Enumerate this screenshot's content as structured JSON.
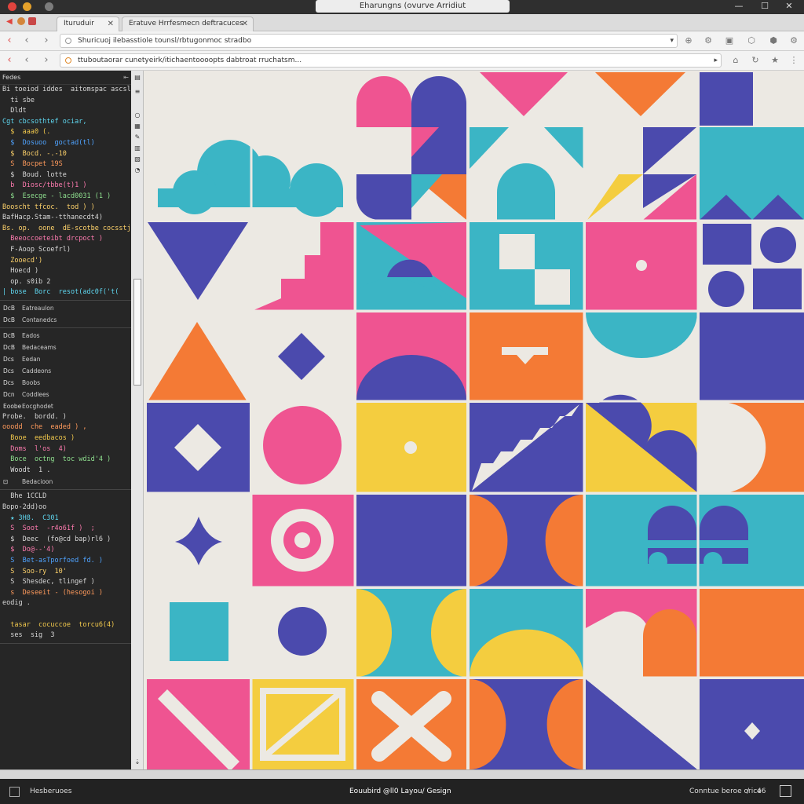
{
  "window": {
    "title": "Eharungns (ovurve Arridiut",
    "minimize_glyph": "—",
    "maximize_glyph": "☐",
    "close_glyph": "✕"
  },
  "tabs": [
    {
      "label": "Ituruduir",
      "close": "✕"
    },
    {
      "label": "Eratuve Hrrfesmecn deftracuces",
      "close": "✕"
    }
  ],
  "nav1": {
    "url": "Shuricuoj ilebasstiole tounsl/rbtugonmoc stradbo"
  },
  "nav2": {
    "url": "ttuboutaorar cunetyeirk/itichaentoooopts dabtroat rruchatsm..."
  },
  "sidebar": {
    "header": "Fedes",
    "code_lines_1": [
      {
        "text": "Bi toeiod iddes  aitomspac ascslti  t i d",
        "color": "#d8d8d8"
      },
      {
        "text": "  ti sbe",
        "color": "#d8d8d8"
      },
      {
        "text": "  Dldt",
        "color": "#d8d8d8"
      },
      {
        "text": "Cgt cbcsothtef ociar,",
        "color": "#5fd7f0"
      },
      {
        "text": "  $  aaa0 (.",
        "color": "#f2c94c"
      },
      {
        "text": "  $  Dosuoo  goctad(tl)",
        "color": "#4fa3ff"
      },
      {
        "text": "  $  Bocd. -.-10",
        "color": "#ffd36b"
      },
      {
        "text": "  S  Bocpet 19S",
        "color": "#ff9a5c"
      },
      {
        "text": "  $  Boud. lotte",
        "color": "#d8d8d8"
      },
      {
        "text": "  b  Diosc/tbbe(t)1 )",
        "color": "#ff7bb0"
      },
      {
        "text": "  $  Esecge - lacd0031 (1 )",
        "color": "#8fe08f"
      },
      {
        "text": "Booscht tfcoc.  tod ) )",
        "color": "#ffd36b"
      },
      {
        "text": "BafHacp.Stam--tthanecdt4)",
        "color": "#d8d8d8"
      },
      {
        "text": "Bs. op.  oone  dE-scotbe cocsstjt )",
        "color": "#ffd36b"
      },
      {
        "text": "  Beeoccoeteibt drcpoct )",
        "color": "#ff7bb0"
      },
      {
        "text": "  F-Aoop Scoefrl)",
        "color": "#d8d8d8"
      },
      {
        "text": "  Zooecd')",
        "color": "#ffd36b"
      },
      {
        "text": "  Hoecd )",
        "color": "#d8d8d8"
      },
      {
        "text": "  op. s0ib 2",
        "color": "#d8d8d8"
      },
      {
        "text": "| bose  Borc  resot(adc0f('t(",
        "color": "#5fd7f0"
      }
    ],
    "files_1": [
      {
        "icon": "DcB",
        "name": "Eatreaulon"
      },
      {
        "icon": "DcB",
        "name": "Contanedcs"
      }
    ],
    "files_2": [
      {
        "icon": "DcB",
        "name": "Eados"
      },
      {
        "icon": "DcB",
        "name": "Bedaceams"
      },
      {
        "icon": "Dcs",
        "name": "Eedan"
      },
      {
        "icon": "Dcs",
        "name": "Caddeons"
      },
      {
        "icon": "Dcs",
        "name": "Boobs"
      },
      {
        "icon": "Dcn",
        "name": "Coddlees"
      },
      {
        "icon": "Eoobe",
        "name": "Eocghodet"
      }
    ],
    "code_lines_2": [
      {
        "text": "Probe.  bordd. )",
        "color": "#d8d8d8"
      },
      {
        "text": "ooodd  che  eaded ) ,",
        "color": "#ff9a5c"
      },
      {
        "text": "  Booe  eedbacos )",
        "color": "#f2c94c"
      },
      {
        "text": "  Doms  l'os  4)",
        "color": "#ff7bb0"
      },
      {
        "text": "  Boce  octng  toc wdid'4 )",
        "color": "#8fe08f"
      },
      {
        "text": "  Woodt  1 .",
        "color": "#d8d8d8"
      }
    ],
    "files_3": [
      {
        "icon": "⊡",
        "name": "Bedacioon"
      }
    ],
    "code_lines_3": [
      {
        "text": "  Bhe 1CCLD",
        "color": "#d8d8d8"
      },
      {
        "text": "Bopo-2dd)oo",
        "color": "#d8d8d8"
      },
      {
        "text": "  ★ 3H8.  C301",
        "color": "#5fd7f0"
      },
      {
        "text": "  S  Soot  -r4o61f )  ;",
        "color": "#ff7bb0"
      },
      {
        "text": "  $  Deec  (fo@cd bap)rl6 )",
        "color": "#d8d8d8"
      },
      {
        "text": "  $  Do@--'4)",
        "color": "#ff7bb0"
      },
      {
        "text": "  S  Bet-asTporfoed fd. )",
        "color": "#4fa3ff"
      },
      {
        "text": "  S  Soo-ry  10'",
        "color": "#ffd36b"
      },
      {
        "text": "  S  Shesdec, tlingef )",
        "color": "#d8d8d8"
      },
      {
        "text": "  s  Deseeit - (hesogoi )",
        "color": "#ff9a5c"
      },
      {
        "text": "eodig .",
        "color": "#d8d8d8"
      },
      {
        "text": "",
        "color": "#d8d8d8"
      },
      {
        "text": "  tasar  cocuccoe  torcu6(4)",
        "color": "#f2c94c"
      },
      {
        "text": "  ses  sig  3",
        "color": "#d8d8d8"
      }
    ]
  },
  "canvas": {
    "title": "Flat geometric pattern artwork",
    "colors": {
      "pink": "#ef5491",
      "navy": "#4b4aad",
      "teal": "#3bb5c5",
      "orange": "#f47a35",
      "yellow": "#f4cd3f",
      "cream": "#ece9e3"
    }
  },
  "statusbar": {
    "left_label": "Hesberuoes",
    "center_label": "Eouubird @ll0 Layou/ Gesign",
    "right_label": "Conntue beroe orice",
    "zoom": "46"
  }
}
